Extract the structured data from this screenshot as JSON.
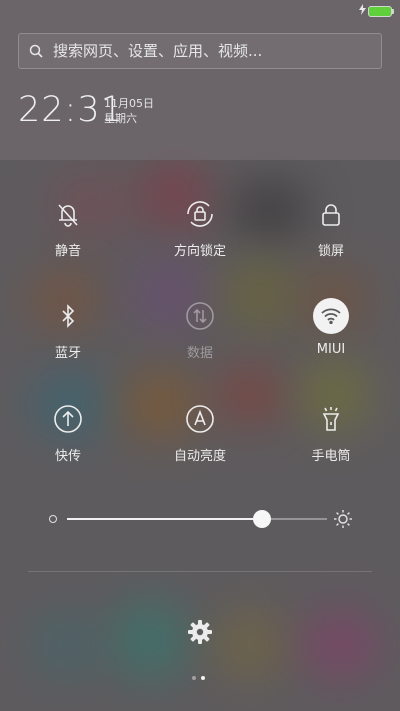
{
  "status": {
    "charging_icon": "bolt-icon",
    "battery_color": "#5fcf3b"
  },
  "search": {
    "placeholder": "搜索网页、设置、应用、视频..."
  },
  "clock": {
    "time": "22:31",
    "date": "11月05日",
    "weekday": "星期六"
  },
  "toggles": [
    {
      "label": "静音",
      "icon": "bell-off-icon",
      "state": "on"
    },
    {
      "label": "方向锁定",
      "icon": "rotation-lock-icon",
      "state": "on"
    },
    {
      "label": "锁屏",
      "icon": "lock-icon",
      "state": "on"
    },
    {
      "label": "蓝牙",
      "icon": "bluetooth-icon",
      "state": "on"
    },
    {
      "label": "数据",
      "icon": "mobile-data-icon",
      "state": "disabled"
    },
    {
      "label": "MIUI",
      "icon": "wifi-icon",
      "state": "active"
    },
    {
      "label": "快传",
      "icon": "upload-icon",
      "state": "on"
    },
    {
      "label": "自动亮度",
      "icon": "auto-brightness-icon",
      "state": "on"
    },
    {
      "label": "手电筒",
      "icon": "flashlight-icon",
      "state": "on"
    }
  ],
  "brightness": {
    "level": 0.75
  },
  "settings_icon": "gear-icon",
  "pager": {
    "pages": 2,
    "current": 2
  }
}
